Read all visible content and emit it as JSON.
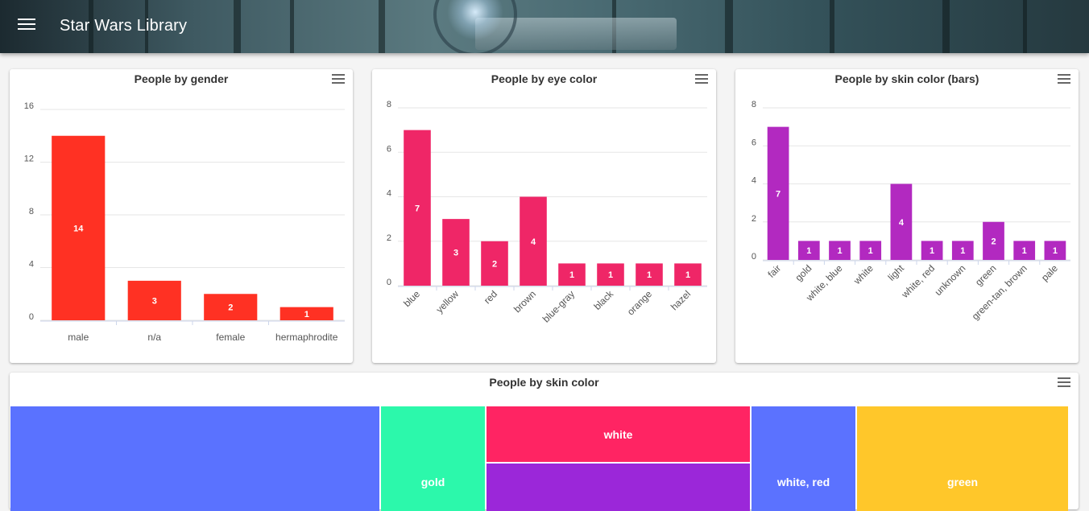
{
  "app": {
    "title": "Star Wars Library",
    "menu_icon": "hamburger-menu-icon"
  },
  "context_menu_icon": "hamburger-context-menu-icon",
  "chart_data": [
    {
      "type": "bar",
      "title": "People by gender",
      "categories": [
        "male",
        "n/a",
        "female",
        "hermaphrodite"
      ],
      "values": [
        14,
        3,
        2,
        1
      ],
      "yticks": [
        0,
        4,
        8,
        12,
        16
      ],
      "ylim": [
        0,
        16
      ],
      "color": "#ff3123",
      "grid": true
    },
    {
      "type": "bar",
      "title": "People by eye color",
      "categories": [
        "blue",
        "yellow",
        "red",
        "brown",
        "blue-gray",
        "black",
        "orange",
        "hazel"
      ],
      "values": [
        7,
        3,
        2,
        4,
        1,
        1,
        1,
        1
      ],
      "yticks": [
        0,
        2,
        4,
        6,
        8
      ],
      "ylim": [
        0,
        8
      ],
      "color": "#ef2667",
      "grid": true
    },
    {
      "type": "bar",
      "title": "People by skin color (bars)",
      "categories": [
        "fair",
        "gold",
        "white, blue",
        "white",
        "light",
        "white, red",
        "unknown",
        "green",
        "green-tan, brown",
        "pale"
      ],
      "values": [
        7,
        1,
        1,
        1,
        4,
        1,
        1,
        2,
        1,
        1
      ],
      "yticks": [
        0,
        2,
        4,
        6,
        8
      ],
      "ylim": [
        0,
        8
      ],
      "color": "#b229c0",
      "grid": true
    },
    {
      "type": "treemap",
      "title": "People by skin color",
      "tiles": [
        {
          "label": "",
          "color": "#5a72ff"
        },
        {
          "label": "gold",
          "color": "#2cf8ab"
        },
        {
          "label": "white",
          "color": "#ff2463"
        },
        {
          "label": "",
          "color": "#9b27d9"
        },
        {
          "label": "white, red",
          "color": "#5b72ff"
        },
        {
          "label": "green",
          "color": "#ffc72a"
        }
      ]
    }
  ]
}
